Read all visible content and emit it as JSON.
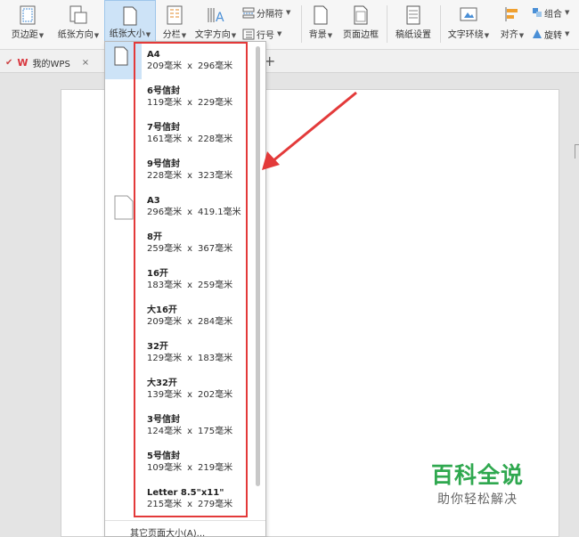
{
  "ribbon": {
    "page_margins": "页边距",
    "orientation": "纸张方向",
    "paper_size": "纸张大小",
    "columns": "分栏",
    "text_direction": "文字方向",
    "separator": "分隔符",
    "line_number": "行号",
    "background": "背景",
    "page_border": "页面边框",
    "manuscript": "稿纸设置",
    "text_wrap": "文字环绕",
    "align": "对齐",
    "group": "组合",
    "rotate": "旋转"
  },
  "tabs": {
    "my_wps": "我的WPS",
    "close": "×",
    "add": "+"
  },
  "paper_sizes": [
    {
      "name": "A4",
      "width": "209毫米",
      "height": "296毫米"
    },
    {
      "name": "6号信封",
      "width": "119毫米",
      "height": "229毫米"
    },
    {
      "name": "7号信封",
      "width": "161毫米",
      "height": "228毫米"
    },
    {
      "name": "9号信封",
      "width": "228毫米",
      "height": "323毫米"
    },
    {
      "name": "A3",
      "width": "296毫米",
      "height": "419.1毫米"
    },
    {
      "name": "8开",
      "width": "259毫米",
      "height": "367毫米"
    },
    {
      "name": "16开",
      "width": "183毫米",
      "height": "259毫米"
    },
    {
      "name": "大16开",
      "width": "209毫米",
      "height": "284毫米"
    },
    {
      "name": "32开",
      "width": "129毫米",
      "height": "183毫米"
    },
    {
      "name": "大32开",
      "width": "139毫米",
      "height": "202毫米"
    },
    {
      "name": "3号信封",
      "width": "124毫米",
      "height": "175毫米"
    },
    {
      "name": "5号信封",
      "width": "109毫米",
      "height": "219毫米"
    },
    {
      "name": "Letter 8.5\"x11\"",
      "width": "215毫米",
      "height": "279毫米"
    }
  ],
  "dimension_separator": "x",
  "more_sizes": "其它页面大小(A)...",
  "watermark": {
    "title": "百科全说",
    "subtitle": "助你轻松解决"
  },
  "colors": {
    "highlight_box": "#e33a3a",
    "active_button": "#cde3f7",
    "watermark": "#2fa84f"
  }
}
